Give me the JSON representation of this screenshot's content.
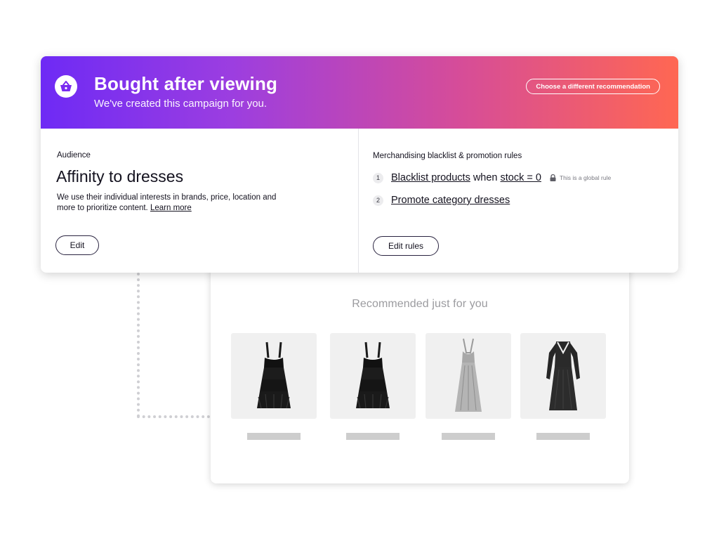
{
  "campaign": {
    "title": "Bought after viewing",
    "subtitle": "We've created this campaign for you.",
    "choose_label": "Choose a different recommendation",
    "icon": "basket-icon",
    "gradient": [
      "#6e2af5",
      "#ff6752"
    ]
  },
  "audience": {
    "label": "Audience",
    "title": "Affinity to dresses",
    "description": "We use their individual interests in brands, price, location and more to prioritize content.",
    "learn_more": "Learn more",
    "edit_label": "Edit"
  },
  "rules": {
    "label": "Merchandising blacklist & promotion rules",
    "items": [
      {
        "number": "1",
        "link1": "Blacklist products",
        "middle": "when",
        "link2": "stock = 0",
        "note": "This is a global rule",
        "note_icon": "lock-icon"
      },
      {
        "number": "2",
        "link1": "Promote category dresses"
      }
    ],
    "edit_label": "Edit rules"
  },
  "preview": {
    "title": "Recommended just for you",
    "products": [
      {
        "icon": "black-tiered-dress-icon"
      },
      {
        "icon": "black-tiered-dress-icon"
      },
      {
        "icon": "silver-gown-icon"
      },
      {
        "icon": "black-long-sleeve-dress-icon"
      }
    ]
  }
}
